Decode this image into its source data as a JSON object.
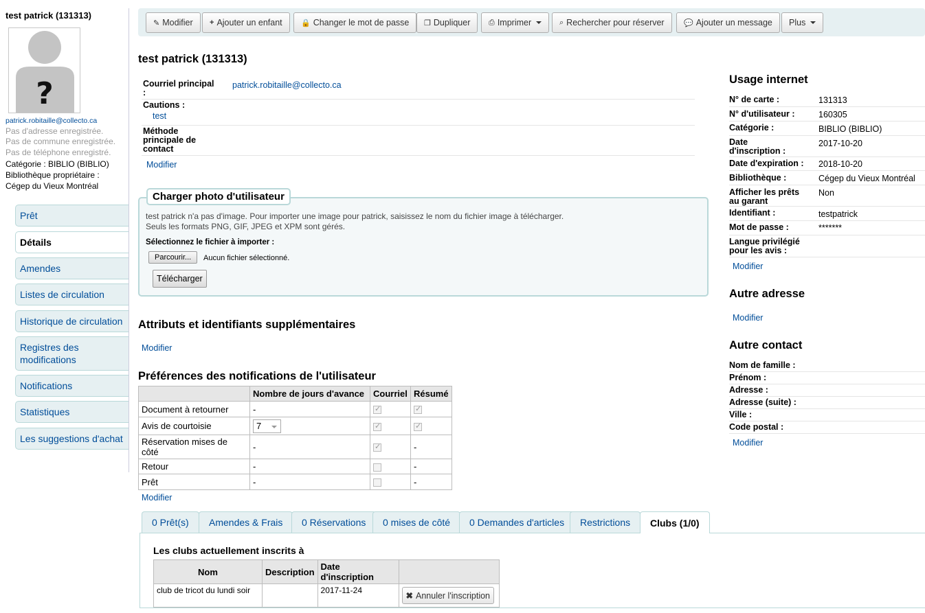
{
  "patron": {
    "name": "test patrick (131313)",
    "email": "patrick.robitaille@collecto.ca",
    "no_address": "Pas d'adresse enregistrée.",
    "no_city": "Pas de commune enregistrée.",
    "no_phone": "Pas de téléphone enregistré.",
    "category_line": "Catégorie : BIBLIO (BIBLIO)",
    "home_library_label": "Bibliothèque propriétaire :",
    "home_library": "Cégep du Vieux Montréal"
  },
  "sidebar": {
    "items": [
      {
        "label": "Prêt"
      },
      {
        "label": "Détails"
      },
      {
        "label": "Amendes"
      },
      {
        "label": "Listes de circulation"
      },
      {
        "label": "Historique de circulation"
      },
      {
        "label": "Registres des modifications"
      },
      {
        "label": "Notifications"
      },
      {
        "label": "Statistiques"
      },
      {
        "label": "Les suggestions d'achat"
      }
    ]
  },
  "toolbar": {
    "edit": "Modifier",
    "add_child": "Ajouter un enfant",
    "change_password": "Changer le mot de passe",
    "duplicate": "Dupliquer",
    "print": "Imprimer",
    "search_hold": "Rechercher pour réserver",
    "add_message": "Ajouter un message",
    "more": "Plus"
  },
  "main": {
    "title": "test patrick (131313)",
    "contact": {
      "primary_email_label": "Courriel principal :",
      "primary_email": "patrick.robitaille@collecto.ca",
      "guarantors_label": "Cautions :",
      "guarantor": "test",
      "primary_contact_label": "Méthode principale de contact",
      "edit": "Modifier"
    },
    "upload": {
      "legend": "Charger photo d'utilisateur",
      "line1": "test patrick n'a pas d'image. Pour importer une image pour patrick, saisissez le nom du fichier image à télécharger.",
      "line2": "Seuls les formats PNG, GIF, JPEG et XPM sont gérés.",
      "select_label": "Sélectionnez le fichier à importer :",
      "browse": "Parcourir...",
      "no_file": "Aucun fichier sélectionné.",
      "upload_button": "Télécharger"
    },
    "attributes": {
      "title": "Attributs et identifiants supplémentaires",
      "edit": "Modifier"
    },
    "notifications": {
      "title": "Préférences des notifications de l'utilisateur",
      "headers": [
        "",
        "Nombre de jours d'avance",
        "Courriel",
        "Résumé"
      ],
      "rows": [
        {
          "name": "Document à retourner",
          "days": "-",
          "email": true,
          "digest": true
        },
        {
          "name": "Avis de courtoisie",
          "days": "7",
          "email": true,
          "digest": true
        },
        {
          "name": "Réservation mises de côté",
          "days": "-",
          "email": true,
          "digest": "-"
        },
        {
          "name": "Retour",
          "days": "-",
          "email": false,
          "digest": "-"
        },
        {
          "name": "Prêt",
          "days": "-",
          "email": false,
          "digest": "-"
        }
      ],
      "edit": "Modifier"
    }
  },
  "right": {
    "internet": {
      "title": "Usage internet",
      "fields": [
        {
          "label": "N° de carte :",
          "value": "131313"
        },
        {
          "label": "N° d'utilisateur :",
          "value": "160305"
        },
        {
          "label": "Catégorie :",
          "value": "BIBLIO (BIBLIO)"
        },
        {
          "label": "Date d'inscription :",
          "value": "2017-10-20"
        },
        {
          "label": "Date d'expiration :",
          "value": "2018-10-20"
        },
        {
          "label": "Bibliothèque :",
          "value": "Cégep du Vieux Montréal"
        },
        {
          "label": "Afficher les prêts au garant",
          "value": "Non"
        },
        {
          "label": "Identifiant :",
          "value": "testpatrick"
        },
        {
          "label": "Mot de passe :",
          "value": "*******"
        },
        {
          "label": "Langue privilégié pour les avis :",
          "value": ""
        }
      ],
      "edit": "Modifier"
    },
    "alt_address": {
      "title": "Autre adresse",
      "edit": "Modifier"
    },
    "alt_contact": {
      "title": "Autre contact",
      "fields": [
        "Nom de famille :",
        "Prénom :",
        "Adresse :",
        "Adresse (suite) :",
        "Ville :",
        "Code postal :"
      ],
      "edit": "Modifier"
    }
  },
  "tabs": {
    "items": [
      {
        "label": "0 Prêt(s)"
      },
      {
        "label": "Amendes & Frais"
      },
      {
        "label": "0 Réservations"
      },
      {
        "label": "0 mises de côté"
      },
      {
        "label": "0 Demandes d'articles"
      },
      {
        "label": "Restrictions"
      },
      {
        "label": "Clubs (1/0)"
      }
    ],
    "clubs": {
      "title": "Les clubs actuellement inscrits à",
      "headers": [
        "Nom",
        "Description",
        "Date d'inscription",
        ""
      ],
      "rows": [
        {
          "name": "club de tricot du lundi soir",
          "description": "",
          "date": "2017-11-24",
          "action": "Annuler l'inscription"
        }
      ]
    }
  }
}
